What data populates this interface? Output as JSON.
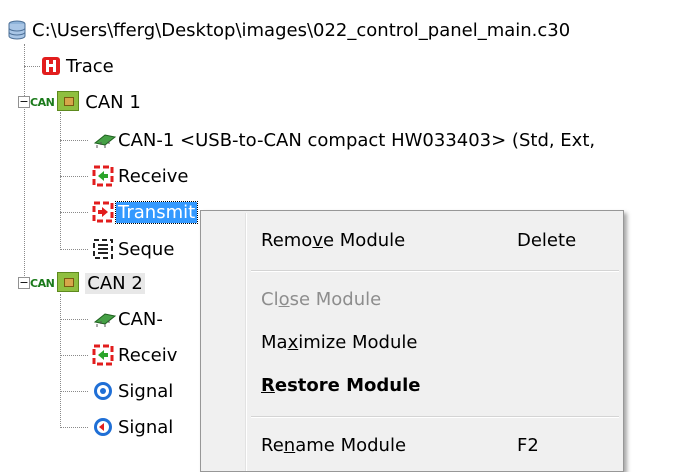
{
  "tree": {
    "root_path": "C:\\Users\\fferg\\Desktop\\images\\022_control_panel_main.c30",
    "trace_label": "Trace",
    "can1": {
      "label": "CAN 1",
      "can_tag": "CAN",
      "device_label": "CAN-1  <USB-to-CAN compact HW033403>  (Std, Ext,",
      "receive_label": "Receive",
      "transmit_label": "Transmit",
      "sequence_label": "Seque"
    },
    "can2": {
      "label": "CAN 2",
      "can_tag": "CAN",
      "device_label": "CAN-",
      "receive_label": "Receiv",
      "signal1_label": "Signal",
      "signal2_label": "Signal"
    }
  },
  "context_menu": {
    "remove": {
      "pre": "Remo",
      "u": "v",
      "post": "e Module",
      "shortcut": "Delete"
    },
    "close": {
      "pre": "Cl",
      "u": "o",
      "post": "se Module"
    },
    "maximize": {
      "pre": "Ma",
      "u": "x",
      "post": "imize Module"
    },
    "restore": {
      "pre": "",
      "u": "R",
      "post": "estore Module"
    },
    "rename": {
      "pre": "Re",
      "u": "n",
      "post": "ame Module",
      "shortcut": "F2"
    }
  },
  "colors": {
    "selection": "#3399ff",
    "menu_bg": "#f0f0f0",
    "disabled_text": "#8d8d8d",
    "icon_red": "#e21d1d",
    "icon_green": "#2aa52a",
    "icon_blue": "#1f6fd6"
  },
  "icons": {
    "root": "database-icon",
    "trace": "trace-icon",
    "can": "can-board-icon",
    "device": "chip-icon",
    "receive": "receive-icon",
    "transmit": "transmit-icon",
    "sequence": "sequence-icon",
    "signal": "signal-icon"
  }
}
